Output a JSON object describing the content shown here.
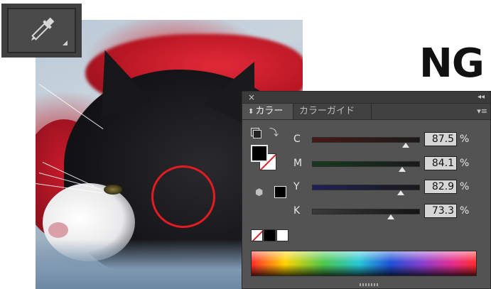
{
  "annotation": {
    "label": "NG",
    "circle_color": "#e51b23"
  },
  "tool": {
    "icon": "eyedropper-icon"
  },
  "panel": {
    "close_label": "×",
    "collapse_label": "◂◂",
    "menu_label": "▾≡",
    "tabs": [
      {
        "label": "カラー",
        "active": true
      },
      {
        "label": "カラーガイド",
        "active": false
      }
    ],
    "sliders": [
      {
        "label": "C",
        "value": "87.5",
        "unit": "%",
        "fraction": 0.875,
        "color": "#4a1818"
      },
      {
        "label": "M",
        "value": "84.1",
        "unit": "%",
        "fraction": 0.841,
        "color": "#153a20"
      },
      {
        "label": "Y",
        "value": "82.9",
        "unit": "%",
        "fraction": 0.829,
        "color": "#20205a"
      },
      {
        "label": "K",
        "value": "73.3",
        "unit": "%",
        "fraction": 0.733,
        "color": "#3a3a3a"
      }
    ],
    "fill_color": "#000000",
    "stroke": "none"
  }
}
